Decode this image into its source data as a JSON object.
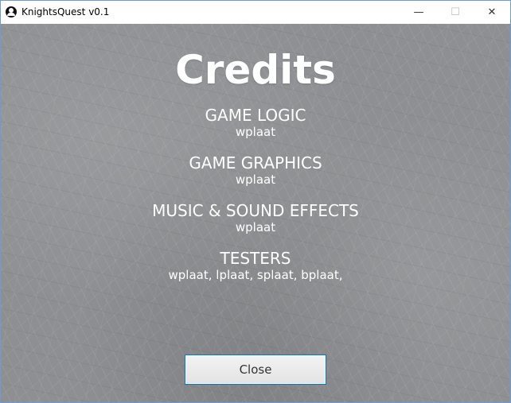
{
  "window": {
    "title": "KnightsQuest v0.1",
    "controls": {
      "minimize": "—",
      "maximize": "☐",
      "close": "✕"
    }
  },
  "credits": {
    "heading": "Credits",
    "sections": [
      {
        "title": "GAME LOGIC",
        "names": "wplaat"
      },
      {
        "title": "GAME GRAPHICS",
        "names": "wplaat"
      },
      {
        "title": "MUSIC & SOUND EFFECTS",
        "names": "wplaat"
      },
      {
        "title": "TESTERS",
        "names": "wplaat, lplaat, splaat, bplaat,"
      }
    ],
    "close_label": "Close"
  },
  "colors": {
    "text": "#ffffff",
    "button_border": "#0078d7",
    "background": "#8d8f92"
  }
}
